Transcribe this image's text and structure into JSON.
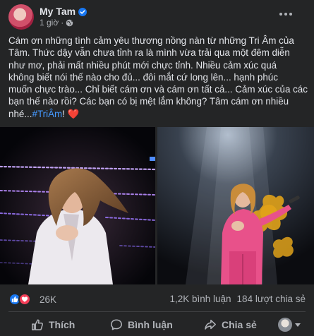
{
  "post": {
    "author": "My Tam",
    "time": "1 giờ",
    "separator": "·",
    "caption_lines": [
      "Cám ơn những tình cảm yêu thương nồng nàn từ những Tri Âm của",
      "Tâm. Thức dậy vẫn chưa tỉnh ra là mình vừa trải qua một đêm diễn",
      "như mơ, phải mất nhiều phút mới chực tỉnh. Nhiều cảm xúc quá",
      "không biết nói thế nào cho đủ... đôi mắt cứ long lên... hạnh phúc",
      "muốn chực trào... Chỉ biết cám ơn và cám ơn tất cả... Cảm xúc của các",
      "bạn thế nào rồi? Các bạn có bị mệt lắm không? Tâm cám ơn nhiều"
    ],
    "caption_last_prefix": "nhé...",
    "hashtag": "#TriÂm",
    "caption_last_suffix": "!",
    "heart_emoji": "❤️"
  },
  "stats": {
    "reactions_count": "26K",
    "comments": "1,2K bình luận",
    "shares": "184 lượt chia sẻ"
  },
  "actions": {
    "like": "Thích",
    "comment": "Bình luận",
    "share": "Chia sẻ"
  },
  "colors": {
    "background": "#242526",
    "text": "#e4e6eb",
    "secondary": "#b0b3b8",
    "link": "#4599ff",
    "like_blue": "#1877f2",
    "love_red": "#f33e58",
    "suit_pink": "#e8518a"
  },
  "icons": [
    "verified-badge-icon",
    "globe-icon",
    "more-icon",
    "like-reaction-icon",
    "love-reaction-icon",
    "thumbs-up-icon",
    "comment-icon",
    "share-icon",
    "chevron-down-icon"
  ]
}
